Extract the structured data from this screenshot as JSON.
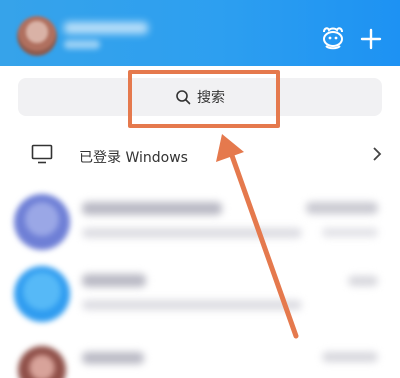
{
  "search": {
    "label": "搜索"
  },
  "devices": {
    "login_label": "已登录 Windows"
  },
  "colors": {
    "header_blue": "#2d9ff0",
    "highlight_orange": "#e5794d",
    "search_bg": "#f1f1f3"
  },
  "icons": {
    "header_left": "mascot-face-icon",
    "header_right": "plus-icon",
    "search": "magnifier-icon",
    "device": "monitor-icon",
    "row_action": "chevron-right-icon"
  }
}
